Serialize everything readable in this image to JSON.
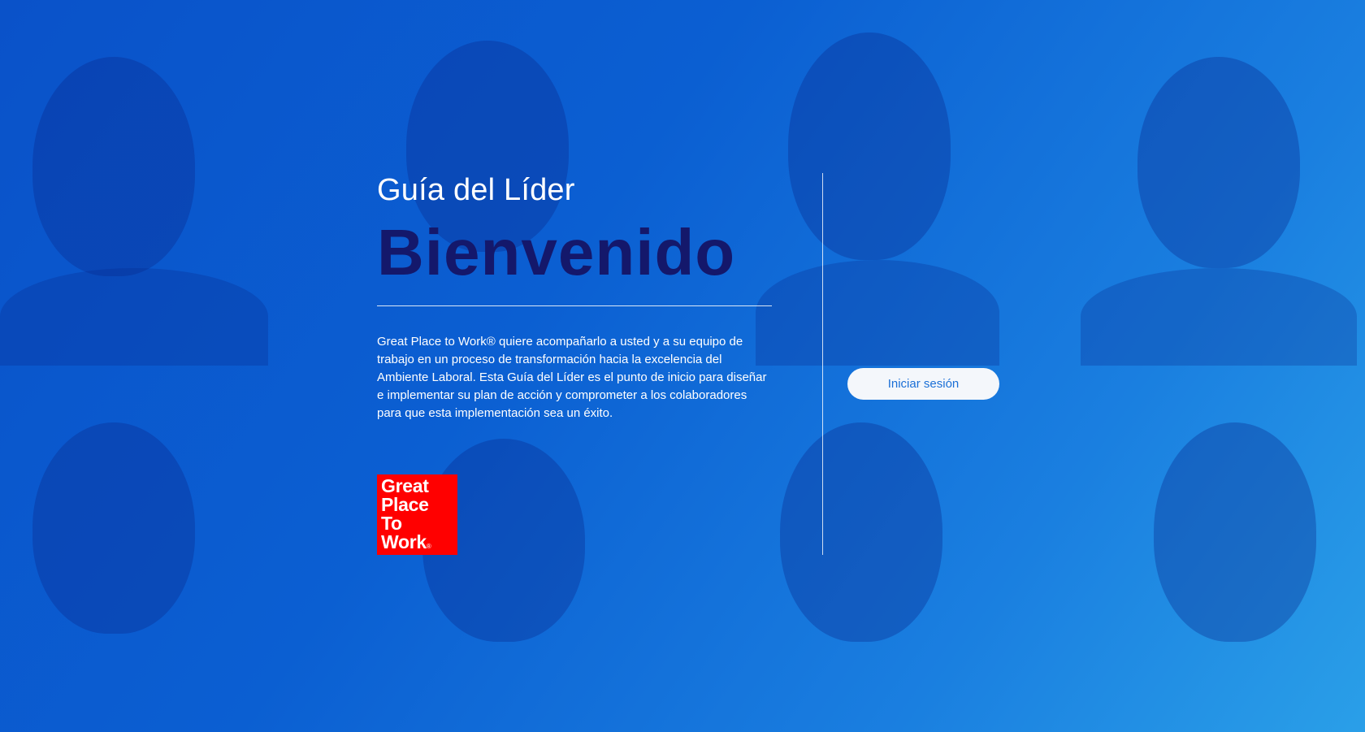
{
  "page": {
    "subtitle": "Guía del Líder",
    "title": "Bienvenido",
    "description": "Great Place to Work® quiere acompañarlo a usted y a su equipo de trabajo en un proceso de transformación hacia la excelencia del Ambiente Laboral. Esta Guía del Líder es el punto de inicio para diseñar e implementar su plan de acción y comprometer a los colaboradores para que esta implementación sea un éxito."
  },
  "logo": {
    "lines": [
      "Great",
      "Place",
      "To",
      "Work"
    ],
    "registered_mark": "®",
    "color": "#ff0000"
  },
  "login": {
    "button_label": "Iniciar sesión"
  },
  "colors": {
    "background": "#0b5fd2",
    "title": "#14186b",
    "button_text": "#1a6fd6"
  }
}
